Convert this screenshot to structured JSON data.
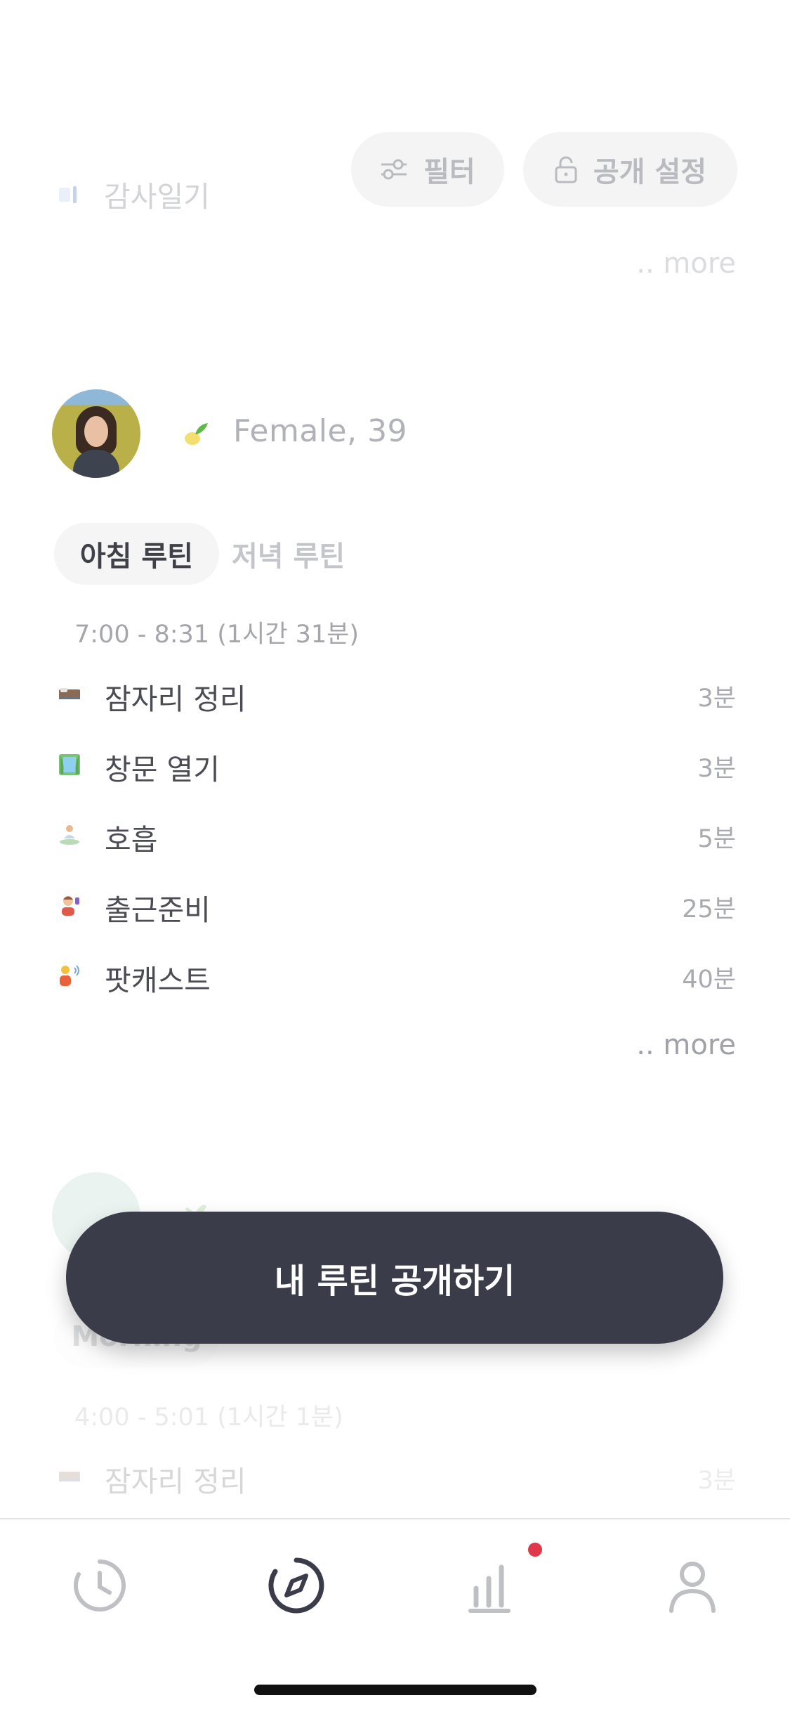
{
  "previous_card": {
    "item_label": "감사일기",
    "more_label": ".. more"
  },
  "toolbar": {
    "filter_label": "필터",
    "privacy_label": "공개 설정"
  },
  "profile": {
    "info": "Female, 39"
  },
  "tabs": {
    "morning": "아침 루틴",
    "evening": "저녁 루틴"
  },
  "routine": {
    "time_range": "7:00 - 8:31 (1시간 31분)",
    "items": [
      {
        "icon": "bed-icon",
        "name": "잠자리 정리",
        "duration": "3분"
      },
      {
        "icon": "window-curtain-icon",
        "name": "창문 열기",
        "duration": "3분"
      },
      {
        "icon": "meditation-icon",
        "name": "호흡",
        "duration": "5분"
      },
      {
        "icon": "getting-ready-icon",
        "name": "출근준비",
        "duration": "25분"
      },
      {
        "icon": "podcast-listener-icon",
        "name": "팟캐스트",
        "duration": "40분"
      }
    ],
    "more_label": ".. more"
  },
  "next_card": {
    "tab_label": "Morning",
    "time_range": "4:00 - 5:01 (1시간 1분)",
    "first_item": {
      "name": "잠자리 정리",
      "duration": "3분"
    }
  },
  "cta": {
    "label": "내 루틴 공개하기"
  },
  "tabbar": {
    "items": [
      "history-clock-icon",
      "explore-compass-icon",
      "stats-bars-icon",
      "profile-person-icon"
    ],
    "active": "explore-compass-icon",
    "badge_color": "#e0384a"
  },
  "colors": {
    "cta_background": "#3b3c4a",
    "accent_badge": "#e0384a"
  }
}
